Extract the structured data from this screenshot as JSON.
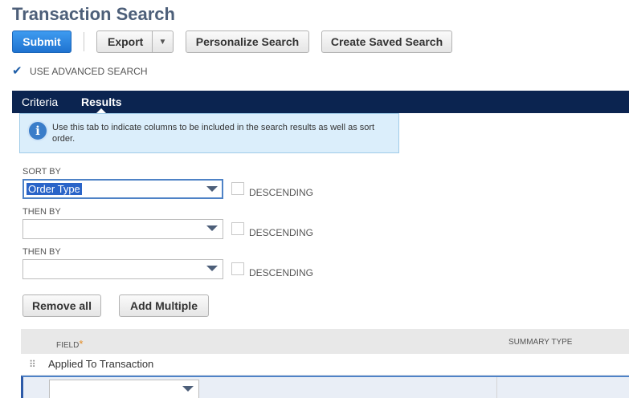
{
  "page": {
    "title": "Transaction Search"
  },
  "toolbar": {
    "submit": "Submit",
    "export": "Export",
    "export_arrow": "▼",
    "personalize": "Personalize Search",
    "create_saved": "Create Saved Search"
  },
  "advanced_search": {
    "label": "USE ADVANCED SEARCH",
    "checked": true
  },
  "tabs": [
    {
      "label": "Criteria",
      "active": false
    },
    {
      "label": "Results",
      "active": true
    }
  ],
  "info": {
    "icon": "info-icon",
    "text": "Use this tab to indicate columns to be included in the search results as well as sort order."
  },
  "sort": [
    {
      "label": "SORT BY",
      "value": "Order Type",
      "descending_label": "DESCENDING",
      "descending": false
    },
    {
      "label": "THEN BY",
      "value": "",
      "descending_label": "DESCENDING",
      "descending": false
    },
    {
      "label": "THEN BY",
      "value": "",
      "descending_label": "DESCENDING",
      "descending": false
    }
  ],
  "actions": {
    "remove_all": "Remove all",
    "add_multiple": "Add Multiple"
  },
  "table": {
    "headers": {
      "field": "FIELD",
      "required_mark": "*",
      "summary_type": "SUMMARY TYPE"
    },
    "rows": [
      {
        "field": "Applied To Transaction",
        "summary_type": ""
      }
    ]
  },
  "colors": {
    "primary": "#1f73d0",
    "tabbar": "#0b2450",
    "info_bg": "#dbeefb",
    "title": "#4d5f79",
    "required": "#e38b24"
  }
}
